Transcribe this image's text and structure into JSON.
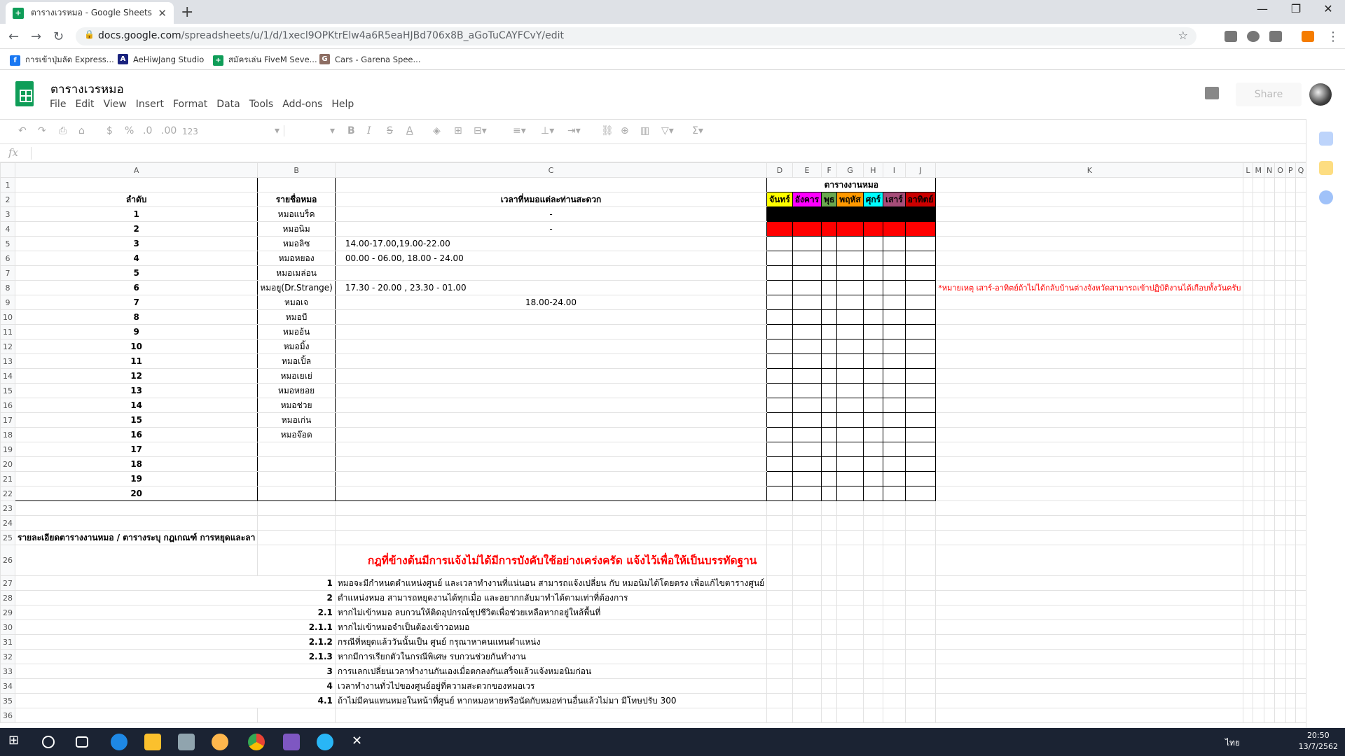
{
  "browser": {
    "tab_title": "ตารางเวรหมอ - Google Sheets",
    "url_domain": "docs.google.com",
    "url_path": "/spreadsheets/u/1/d/1xecl9OPKtrElw4a6R5eaHJBd706x8B_aGoTuCAYFCvY/edit",
    "bookmarks": [
      {
        "label": "การเข้าปุ่มลัด Express...",
        "icon": "facebook-icon",
        "color": "#1877f2"
      },
      {
        "label": "AeHiwJang Studio",
        "icon": "studio-icon",
        "color": "#1a237e"
      },
      {
        "label": "สมัครเล่น FiveM Seve...",
        "icon": "sheets-icon",
        "color": "#0f9d58"
      },
      {
        "label": "Cars - Garena Spee...",
        "icon": "garena-icon",
        "color": "#8d6e63"
      }
    ]
  },
  "sheets": {
    "doc_title": "ตารางเวรหมอ",
    "menu": [
      "File",
      "Edit",
      "View",
      "Insert",
      "Format",
      "Data",
      "Tools",
      "Add-ons",
      "Help"
    ],
    "share_label": "Share",
    "fx_label": "fx",
    "toolbar": {
      "dollar": "$",
      "percent": "%",
      "dec_less": ".0",
      "dec_more": ".00",
      "format_more": "123"
    }
  },
  "grid": {
    "columns": [
      "A",
      "B",
      "C",
      "D",
      "E",
      "F",
      "G",
      "H",
      "I",
      "J",
      "K",
      "L",
      "M",
      "N",
      "O",
      "P",
      "Q"
    ],
    "schedule_title": "ตารางงานหมอ",
    "headers": {
      "order": "ลำดับ",
      "name": "รายชื่อหมอ",
      "time": "เวลาที่หมอแต่ละท่านสะดวก"
    },
    "days": [
      {
        "label": "จันทร์",
        "color": "#ffff00"
      },
      {
        "label": "อังคาร",
        "color": "#ff00ff"
      },
      {
        "label": "พุธ",
        "color": "#6aa84f"
      },
      {
        "label": "พฤหัส",
        "color": "#ff9900"
      },
      {
        "label": "ศุกร์",
        "color": "#00ffff"
      },
      {
        "label": "เสาร์",
        "color": "#a64d79"
      },
      {
        "label": "อาทิตย์",
        "color": "#cc0000"
      }
    ],
    "doctors": [
      {
        "no": "1",
        "name": "หมอแบร็ค",
        "time": "-",
        "fill": "#000000"
      },
      {
        "no": "2",
        "name": "หมอนิม",
        "time": "-",
        "fill": "#ff0000"
      },
      {
        "no": "3",
        "name": "หมอลิซ",
        "time": "14.00-17.00,19.00-22.00",
        "fill": ""
      },
      {
        "no": "4",
        "name": "หมอหยอง",
        "time": "00.00 - 06.00, 18.00 - 24.00",
        "fill": ""
      },
      {
        "no": "5",
        "name": "หมอเมล่อน",
        "time": "",
        "fill": ""
      },
      {
        "no": "6",
        "name": "หมอยู(Dr.Strange)",
        "time": "17.30 - 20.00 , 23.30 - 01.00",
        "fill": ""
      },
      {
        "no": "7",
        "name": "หมอเจ",
        "time": "18.00-24.00",
        "fill": ""
      },
      {
        "no": "8",
        "name": "หมอบี",
        "time": "",
        "fill": ""
      },
      {
        "no": "9",
        "name": "หมออ้น",
        "time": "",
        "fill": ""
      },
      {
        "no": "10",
        "name": "หมอมิ้ง",
        "time": "",
        "fill": ""
      },
      {
        "no": "11",
        "name": "หมอเปิ้ล",
        "time": "",
        "fill": ""
      },
      {
        "no": "12",
        "name": "หมอเยเย่",
        "time": "",
        "fill": ""
      },
      {
        "no": "13",
        "name": "หมอหยอย",
        "time": "",
        "fill": ""
      },
      {
        "no": "14",
        "name": "หมอช่วย",
        "time": "",
        "fill": ""
      },
      {
        "no": "15",
        "name": "หมอเก่น",
        "time": "",
        "fill": ""
      },
      {
        "no": "16",
        "name": "หมอจ๊อด",
        "time": "",
        "fill": ""
      },
      {
        "no": "17",
        "name": "",
        "time": "",
        "fill": ""
      },
      {
        "no": "18",
        "name": "",
        "time": "",
        "fill": ""
      },
      {
        "no": "19",
        "name": "",
        "time": "",
        "fill": ""
      },
      {
        "no": "20",
        "name": "",
        "time": "",
        "fill": ""
      }
    ],
    "note": "*หมายเหตุ เสาร์-อาทิตย์ถ้าไม่ได้กลับบ้านต่างจังหวัดสามารถเข้าปฏิบัติงานได้เกือบทั้งวันครับ",
    "rules_heading": "รายละเอียดตารางงานหมอ / ตารางระบุ กฎเกณฑ์ การหยุดและลา",
    "rules_banner": "กฎที่ข้างต้นมีการแจ้งไม่ได้มีการบังคับใช้อย่างเคร่งครัด แจ้งไว้เพื่อให้เป็นบรรทัดฐาน",
    "rules": [
      {
        "no": "1",
        "text": "หมอจะมีกำหนดตำแหน่งศูนย์ และเวลาทำงานที่แน่นอน สามารถแจ้งเปลี่ยน กับ หมอนิมได้โดยตรง เพื่อแก้ไขตารางศูนย์"
      },
      {
        "no": "2",
        "text": "ตำแหน่งหมอ สามารถหยุดงานได้ทุกเมื่อ และอยากกลับมาทำได้ตามเท่าที่ต้องการ"
      },
      {
        "no": "2.1",
        "text": "หากไม่เข้าหมอ ลบกวนให้ติดอุปกรณ์ชุปชีวิตเพื่อช่วยเหลือหากอยู่ใหล้พื้นที่"
      },
      {
        "no": "2.1.1",
        "text": "หากไม่เข้าหมอจำเป็นต้องเข้าวอหมอ"
      },
      {
        "no": "2.1.2",
        "text": "กรณีที่หยุดแล้ววันนั้นเป็น ศูนย์ กรุณาหาคนแทนตำแหน่ง"
      },
      {
        "no": "2.1.3",
        "text": "หากมีการเรียกตัวในกรณีพิเศษ รบกวนช่วยกันทำงาน"
      },
      {
        "no": "3",
        "text": "การแลกเปลี่ยนเวลาทำงานกันเองเมื่อตกลงกันเสร็จแล้วแจ้งหมอนิมก่อน"
      },
      {
        "no": "4",
        "text": "เวลาทำงานทั่วไปของศูนย์อยู่ที่ความสะดวกของหมอเวร"
      },
      {
        "no": "4.1",
        "text": "ถ้าไม่มีคนแทนหมอในหน้าที่ศูนย์ หากหมอหายหรือนัดกับหมอท่านอื่นแล้วไม่มา มีโทษปรับ 300"
      }
    ],
    "row_count": 36
  },
  "taskbar": {
    "time": "20:50",
    "date": "13/7/2562",
    "lang": "ไทย"
  },
  "colors": {
    "note_red": "#ff0000",
    "sheets_green": "#0f9d58",
    "taskbar": "#1b2333"
  }
}
